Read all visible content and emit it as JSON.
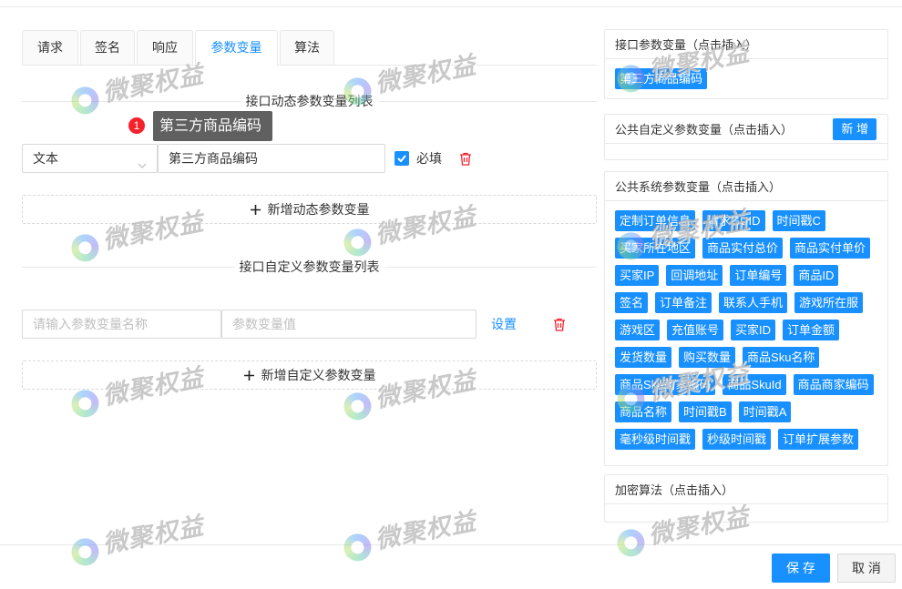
{
  "tabs": [
    {
      "label": "请求",
      "active": false
    },
    {
      "label": "签名",
      "active": false
    },
    {
      "label": "响应",
      "active": false
    },
    {
      "label": "参数变量",
      "active": true
    },
    {
      "label": "算法",
      "active": false
    }
  ],
  "dynamic_section": {
    "title": "接口动态参数变量列表",
    "hint": {
      "badge": "1",
      "text": "第三方商品编码"
    },
    "rows": [
      {
        "type": "文本",
        "value": "第三方商品编码",
        "required": true,
        "required_label": "必填"
      }
    ],
    "add_label": "新增动态参数变量"
  },
  "custom_section": {
    "title": "接口自定义参数变量列表",
    "rows": [
      {
        "name_placeholder": "请输入参数变量名称",
        "value_placeholder": "参数变量值",
        "set_label": "设置"
      }
    ],
    "add_label": "新增自定义参数变量"
  },
  "side": {
    "interface_vars": {
      "title": "接口参数变量（点击插入）",
      "tags": [
        "第三方商品编码"
      ]
    },
    "public_custom": {
      "title": "公共自定义参数变量（点击插入）",
      "add_label": "新 增"
    },
    "public_system": {
      "title": "公共系统参数变量（点击插入）",
      "tags": [
        "定制订单信息",
        "请求GUID",
        "时间戳C",
        "买家所在地区",
        "商品实付总价",
        "商品实付单价",
        "买家IP",
        "回调地址",
        "订单编号",
        "商品ID",
        "签名",
        "订单备注",
        "联系人手机",
        "游戏所在服",
        "游戏区",
        "充值账号",
        "买家ID",
        "订单金额",
        "发货数量",
        "购买数量",
        "商品Sku名称",
        "商品Sku商家编码",
        "商品SkuId",
        "商品商家编码",
        "商品名称",
        "时间戳B",
        "时间戳A",
        "毫秒级时间戳",
        "秒级时间戳",
        "订单扩展参数"
      ]
    },
    "encrypt": {
      "title": "加密算法（点击插入）"
    }
  },
  "footer": {
    "save_label": "保 存",
    "cancel_label": "取 消"
  },
  "watermark": {
    "text": "微聚权益"
  },
  "icons": [
    "chevron-down-icon",
    "check-icon",
    "trash-icon",
    "plus-icon",
    "watermark-logo"
  ],
  "colors": {
    "primary": "#1890ff",
    "danger": "#f5222d",
    "tooltip_bg": "#606060",
    "border": "#e8e8e8"
  }
}
